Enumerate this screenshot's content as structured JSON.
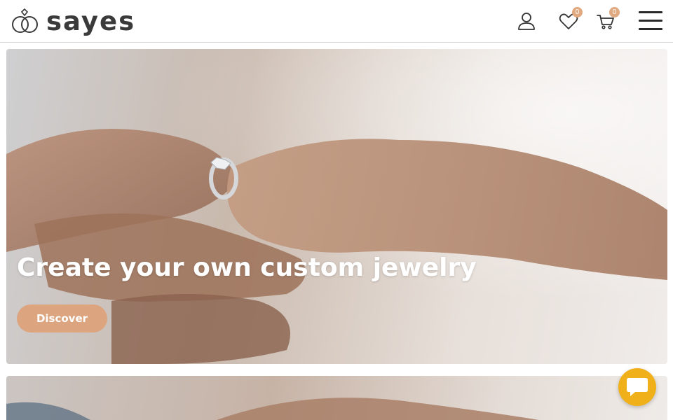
{
  "header": {
    "logo_text": "sayes",
    "wishlist_count": "0",
    "cart_count": "0"
  },
  "hero": {
    "title": "Create your own custom jewelry",
    "button_label": "Discover"
  },
  "icons": {
    "logo": "rings-logo-icon",
    "account": "user-icon",
    "wishlist": "heart-icon",
    "cart": "cart-icon",
    "menu": "hamburger-menu-icon",
    "chat": "chat-icon"
  },
  "colors": {
    "accent": "#dca57f",
    "badge": "#e0a97f",
    "chat": "#f0b01a",
    "text_dark": "#3a3a3a"
  }
}
